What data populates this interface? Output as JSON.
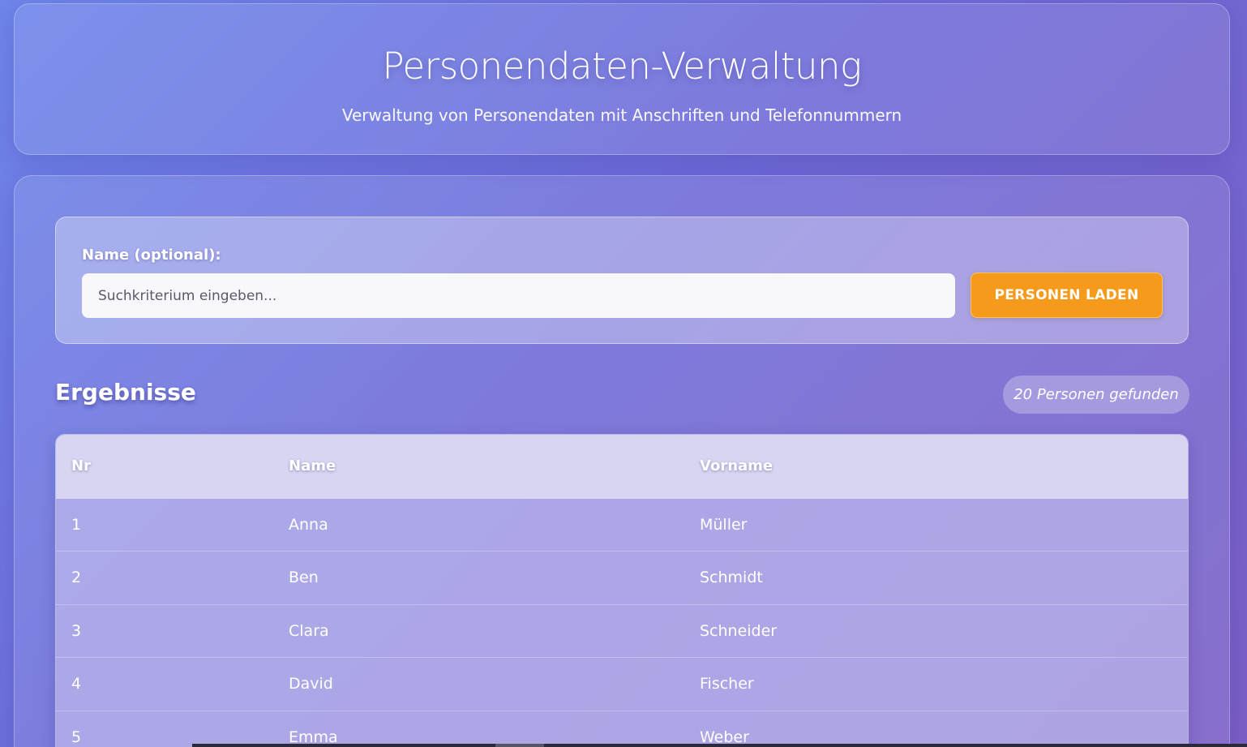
{
  "header": {
    "title": "Personendaten-Verwaltung",
    "subtitle": "Verwaltung von Personendaten mit Anschriften und Telefonnummern"
  },
  "search": {
    "label": "Name (optional):",
    "placeholder": "Suchkriterium eingeben...",
    "value": "",
    "button_label": "PERSONEN LADEN"
  },
  "results": {
    "heading": "Ergebnisse",
    "count_text": "20 Personen gefunden",
    "columns": [
      "Nr",
      "Name",
      "Vorname"
    ],
    "rows": [
      {
        "nr": "1",
        "name": "Anna",
        "vorname": "Müller"
      },
      {
        "nr": "2",
        "name": "Ben",
        "vorname": "Schmidt"
      },
      {
        "nr": "3",
        "name": "Clara",
        "vorname": "Schneider"
      },
      {
        "nr": "4",
        "name": "David",
        "vorname": "Fischer"
      },
      {
        "nr": "5",
        "name": "Emma",
        "vorname": "Weber"
      }
    ]
  },
  "colors": {
    "accent_button": "#f59a1b",
    "background_start": "#6e86ea",
    "background_end": "#7b5fc6"
  }
}
